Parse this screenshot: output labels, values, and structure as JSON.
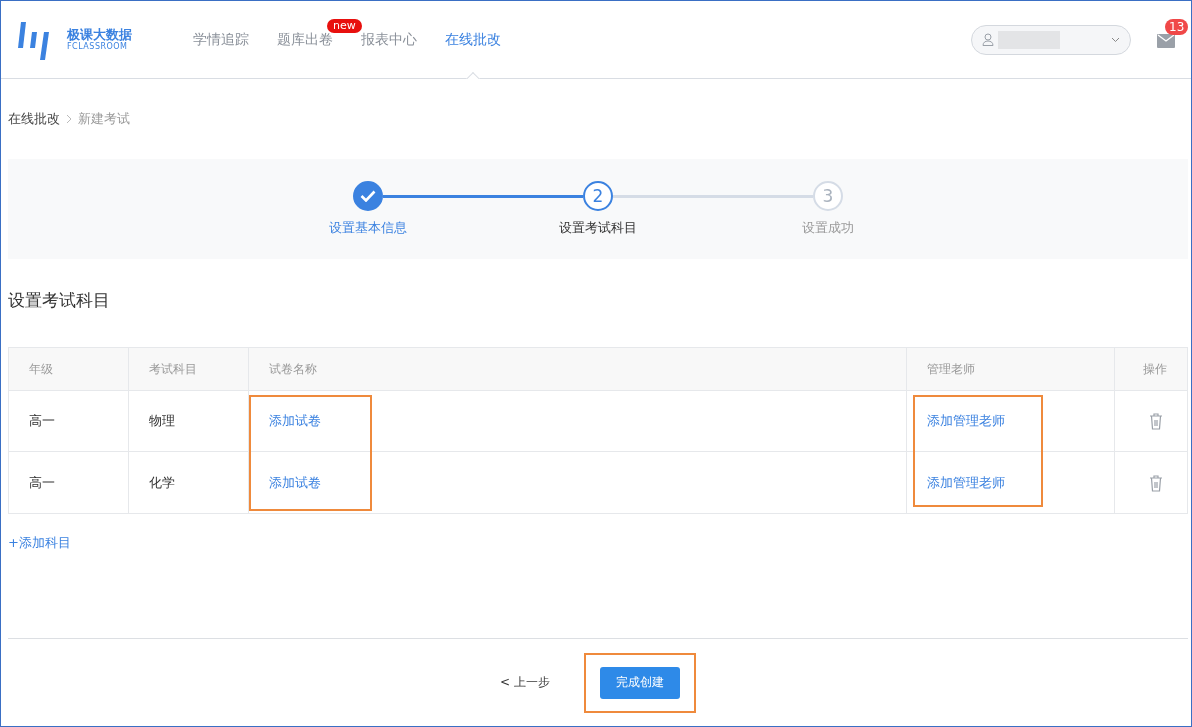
{
  "header": {
    "logo": {
      "name": "极课大数据",
      "sub": "FCLASSROOM"
    },
    "nav": [
      {
        "label": "学情追踪",
        "selected": false
      },
      {
        "label": "题库出卷",
        "selected": false,
        "badge": "new"
      },
      {
        "label": "报表中心",
        "selected": false
      },
      {
        "label": "在线批改",
        "selected": true
      }
    ],
    "mail_badge": "13"
  },
  "breadcrumb": [
    {
      "label": "在线批改"
    },
    {
      "label": "新建考试"
    }
  ],
  "steps": [
    {
      "label": "设置基本信息",
      "done": true,
      "selected": false
    },
    {
      "number": "2",
      "label": "设置考试科目",
      "done": false,
      "selected": true
    },
    {
      "number": "3",
      "label": "设置成功",
      "done": false,
      "selected": false
    }
  ],
  "section_title": "设置考试科目",
  "table": {
    "columns": [
      {
        "label": "年级",
        "highlighted": false
      },
      {
        "label": "考试科目",
        "highlighted": false
      },
      {
        "label": "试卷名称",
        "highlighted": true
      },
      {
        "label": "管理老师",
        "highlighted": true
      },
      {
        "label": "操作",
        "highlighted": false
      }
    ],
    "rows": [
      {
        "grade": "高一",
        "subject": "物理",
        "paper": "添加试卷",
        "teacher": "添加管理老师"
      },
      {
        "grade": "高一",
        "subject": "化学",
        "paper": "添加试卷",
        "teacher": "添加管理老师"
      }
    ]
  },
  "add_subject": "+添加科目",
  "footer": {
    "back": "< 上一步",
    "submit": {
      "label": "完成创建",
      "highlighted": true
    }
  }
}
